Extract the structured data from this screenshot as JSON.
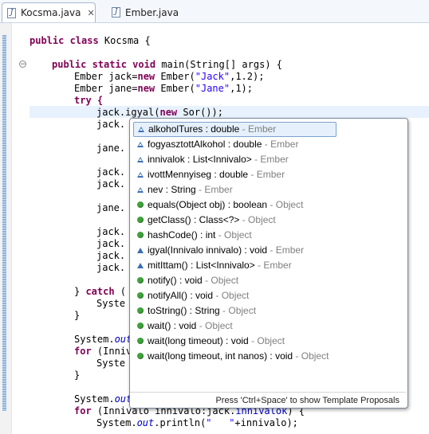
{
  "tabs": [
    {
      "label": "Kocsma.java",
      "active": true,
      "close": "✕"
    },
    {
      "label": "Ember.java",
      "active": false
    }
  ],
  "code": {
    "l1": "public class Kocsma {",
    "l2": "public static void main(String[] args) {",
    "l3a": "Ember jack=",
    "l3b": "new",
    "l3c": " Ember(",
    "l3d": "\"Jack\"",
    "l3e": ",1.2);",
    "l4a": "Ember jane=",
    "l4b": "new",
    "l4c": " Ember(",
    "l4d": "\"Jane\"",
    "l4e": ",1);",
    "l5": "try {",
    "l6a": "jack.igyal(",
    "l6b": "new",
    "l6c": " Sor());",
    "frag": [
      "jack.",
      "jane.",
      "jack.",
      "jack.",
      "jane.",
      "jack.",
      "jack.",
      "jack.",
      "jack."
    ],
    "catch_a": "} ",
    "catch_b": "catch",
    "catch_c": " (",
    "syst1": "Syste",
    "close1": "}",
    "sys_out_a": "System.",
    "sys_out_b": "out",
    "for_a": "for",
    "for_b": " (Inniv",
    "syst2": "Syste",
    "close2": "}",
    "sys_out2_a": "System.",
    "sys_out2_b": "out",
    "for2_a": "for",
    "for2_b": " (Innivalo innivalo:jack.",
    "for2_c": "innivalok",
    "for2_d": ") {",
    "println_a": "System.",
    "println_b": "out",
    "println_c": ".println(",
    "println_d": "\"   \"",
    "println_e": "+innivalo);"
  },
  "popup": {
    "items": [
      {
        "text": "alkoholTures : double",
        "owner": " - Ember",
        "icon": "protected-field-icon",
        "selected": true
      },
      {
        "text": "fogyasztottAlkohol : double",
        "owner": " - Ember",
        "icon": "protected-field-icon"
      },
      {
        "text": "innivalok : List<Innivalo>",
        "owner": " - Ember",
        "icon": "protected-field-icon"
      },
      {
        "text": "ivottMennyiseg : double",
        "owner": " - Ember",
        "icon": "protected-field-icon"
      },
      {
        "text": "nev : String",
        "owner": " - Ember",
        "icon": "protected-field-icon"
      },
      {
        "text": "equals(Object obj) : boolean",
        "owner": " - Object",
        "icon": "public-method-icon"
      },
      {
        "text": "getClass() : Class<?>",
        "owner": " - Object",
        "icon": "public-method-icon"
      },
      {
        "text": "hashCode() : int",
        "owner": " - Object",
        "icon": "public-method-icon"
      },
      {
        "text": "igyal(Innivalo innivalo) : void",
        "owner": " - Ember",
        "icon": "protected-method-icon"
      },
      {
        "text": "mitIttam() : List<Innivalo>",
        "owner": " - Ember",
        "icon": "protected-method-icon"
      },
      {
        "text": "notify() : void",
        "owner": " - Object",
        "icon": "public-method-icon"
      },
      {
        "text": "notifyAll() : void",
        "owner": " - Object",
        "icon": "public-method-icon"
      },
      {
        "text": "toString() : String",
        "owner": " - Object",
        "icon": "public-method-icon"
      },
      {
        "text": "wait() : void",
        "owner": " - Object",
        "icon": "public-method-icon"
      },
      {
        "text": "wait(long timeout) : void",
        "owner": " - Object",
        "icon": "public-method-icon"
      },
      {
        "text": "wait(long timeout, int nanos) : void",
        "owner": " - Object",
        "icon": "public-method-icon"
      }
    ],
    "footer": "Press 'Ctrl+Space' to show Template Proposals"
  },
  "colors": {
    "keyword": "#7f0055",
    "string": "#2a00ff",
    "field": "#0000c0",
    "method_icon": "#3ea33a",
    "field_icon": "#3b6fb6"
  }
}
